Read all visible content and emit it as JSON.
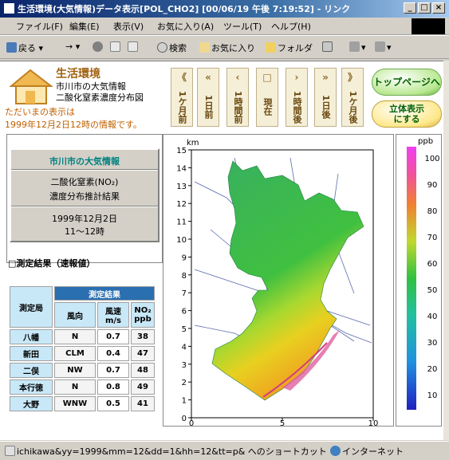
{
  "window": {
    "title": "生活環境(大気情報)データ表示[POL_CHO2] [00/06/19 午後 7:19:52] - リンク"
  },
  "menu": [
    "ファイル(F)",
    "編集(E)",
    "表示(V)",
    "お気に入り(A)",
    "ツール(T)",
    "ヘルプ(H)"
  ],
  "toolbar": {
    "back": "戻る",
    "search": "検索",
    "favorites": "お気に入り",
    "folders": "フォルダ"
  },
  "brand": {
    "title": "生活環境",
    "line1": "市川市の大気情報",
    "line2": "二酸化窒素濃度分布図"
  },
  "note": {
    "line1": "ただいまの表示は",
    "line2": "1999年12月2日12時の情報です。"
  },
  "nav": [
    {
      "arrow": "《",
      "label": "1ケ月前"
    },
    {
      "arrow": "«",
      "label": "1日前"
    },
    {
      "arrow": "‹",
      "label": "1時間前"
    },
    {
      "arrow": "□",
      "label": "現在"
    },
    {
      "arrow": "›",
      "label": "1時間後"
    },
    {
      "arrow": "»",
      "label": "1日後"
    },
    {
      "arrow": "》",
      "label": "1ケ月後"
    }
  ],
  "buttons": {
    "top": "トップページへ",
    "solid1": "立体表示",
    "solid2": "にする"
  },
  "panel": {
    "heading": "市川市の大気情報",
    "sub1": "二酸化窒素(NO₂)",
    "sub2": "濃度分布推計結果",
    "date": "1999年12月2日",
    "time": "11～12時"
  },
  "measured_title": "□測定結果（速報値）",
  "table": {
    "caption": "測定結果",
    "station": "測定局",
    "cols": [
      "風向",
      "風速 m/s",
      "NO₂ ppb"
    ],
    "rows": [
      {
        "name": "八幡",
        "dir": "N",
        "speed": "0.7",
        "no2": "38"
      },
      {
        "name": "新田",
        "dir": "CLM",
        "speed": "0.4",
        "no2": "47"
      },
      {
        "name": "二俣",
        "dir": "NW",
        "speed": "0.7",
        "no2": "48"
      },
      {
        "name": "本行徳",
        "dir": "N",
        "speed": "0.8",
        "no2": "49"
      },
      {
        "name": "大野",
        "dir": "WNW",
        "speed": "0.5",
        "no2": "41"
      }
    ]
  },
  "map": {
    "unit_label": "km",
    "y_ticks": [
      "0",
      "1",
      "2",
      "3",
      "4",
      "5",
      "6",
      "7",
      "8",
      "9",
      "10",
      "11",
      "12",
      "13",
      "14",
      "15"
    ],
    "x_ticks": [
      "0",
      "5",
      "10"
    ]
  },
  "colorbar": {
    "unit": "ppb",
    "ticks": [
      "100",
      "90",
      "80",
      "70",
      "60",
      "50",
      "40",
      "30",
      "20",
      "10"
    ]
  },
  "status": {
    "url": "ichikawa&yy=1999&mm=12&dd=1&hh=12&tt=p& へのショートカット",
    "zone": "インターネット"
  }
}
